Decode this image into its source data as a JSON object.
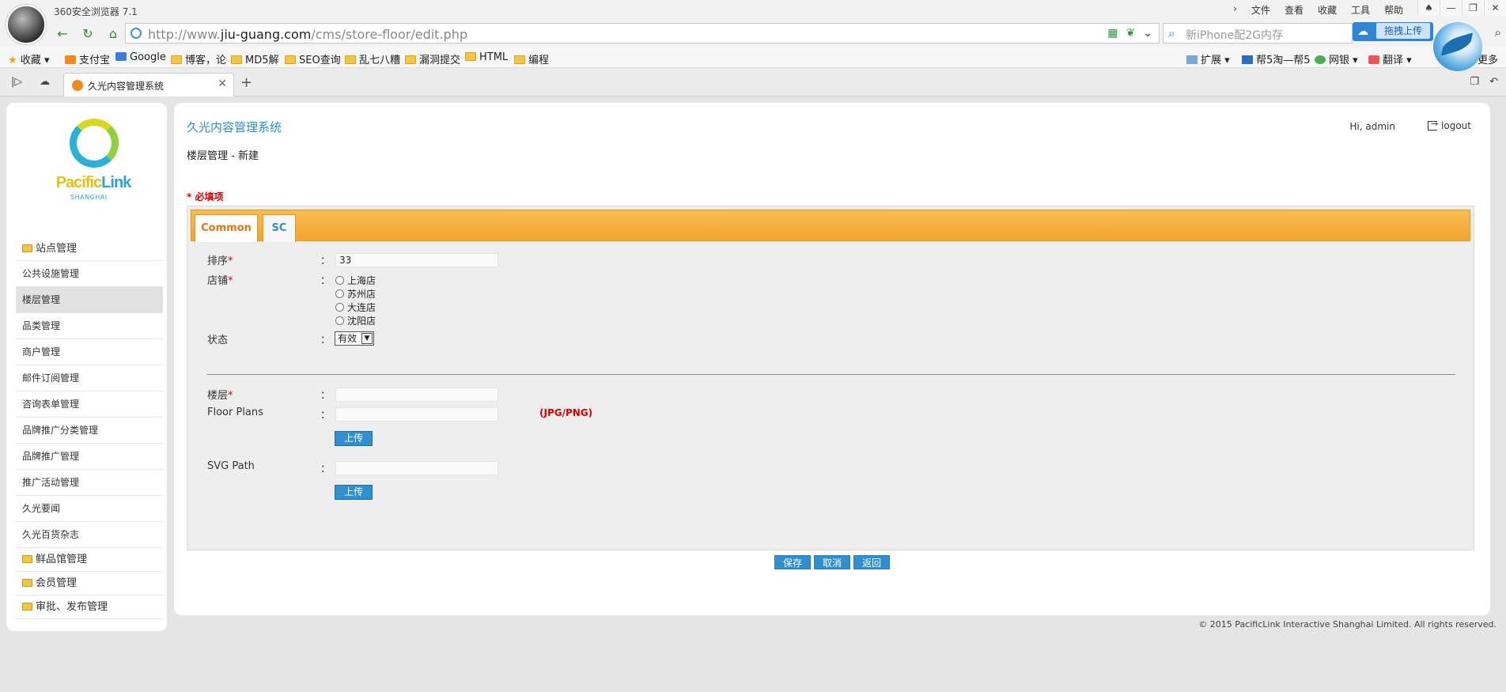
{
  "browser": {
    "app_name": "360安全浏览器 7.1",
    "top_menu": [
      "文件",
      "查看",
      "收藏",
      "工具",
      "帮助"
    ],
    "url_prefix": "http://www.",
    "url_domain": "jiu-guang.com",
    "url_path": "/cms/store-floor/edit.php",
    "search_text": "新iPhone配2G内存",
    "upload_label": "拖拽上传",
    "bookmarks": [
      "收藏",
      "支付宝",
      "Google",
      "博客，论",
      "MD5解",
      "SEO查询",
      "乱七八糟",
      "漏洞提交",
      "HTML",
      "编程"
    ],
    "bm_right": [
      "扩展",
      "帮5淘—帮5",
      "网银",
      "翻译",
      "更多"
    ],
    "tab_title": "久光内容管理系统"
  },
  "sidebar": {
    "logo_text_a": "Pacific",
    "logo_text_b": "Link",
    "logo_sub": "SHANGHAI",
    "items": [
      {
        "label": "站点管理",
        "folder": true
      },
      {
        "label": "公共设施管理"
      },
      {
        "label": "楼层管理",
        "active": true
      },
      {
        "label": "品类管理"
      },
      {
        "label": "商户管理"
      },
      {
        "label": "邮件订阅管理"
      },
      {
        "label": "咨询表单管理"
      },
      {
        "label": "品牌推广分类管理"
      },
      {
        "label": "品牌推广管理"
      },
      {
        "label": "推广活动管理"
      },
      {
        "label": "久光要闻"
      },
      {
        "label": "久光百货杂志"
      },
      {
        "label": "鲜品馆管理",
        "folder": true
      },
      {
        "label": "会员管理",
        "folder": true
      },
      {
        "label": "审批、发布管理",
        "folder": true
      }
    ]
  },
  "header": {
    "system_title": "久光内容管理系统",
    "greeting": "Hi, admin",
    "logout": "logout",
    "breadcrumb": "楼层管理 - 新建",
    "required_note": "* 必填项"
  },
  "form": {
    "tabs": [
      "Common",
      "SC"
    ],
    "colon": "：",
    "sort_label": "排序",
    "sort_value": "33",
    "store_label": "店铺",
    "stores": [
      "上海店",
      "苏州店",
      "大连店",
      "沈阳店"
    ],
    "status_label": "状态",
    "status_value": "有效",
    "floor_label": "楼层",
    "floorplans_label": "Floor Plans",
    "floorplans_hint": "(JPG/PNG)",
    "upload_label": "上传",
    "svg_label": "SVG Path",
    "req_mark": "*"
  },
  "actions": [
    "保存",
    "取消",
    "返回"
  ],
  "footer": "© 2015 PacificLink Interactive Shanghai Limited. All rights reserved."
}
